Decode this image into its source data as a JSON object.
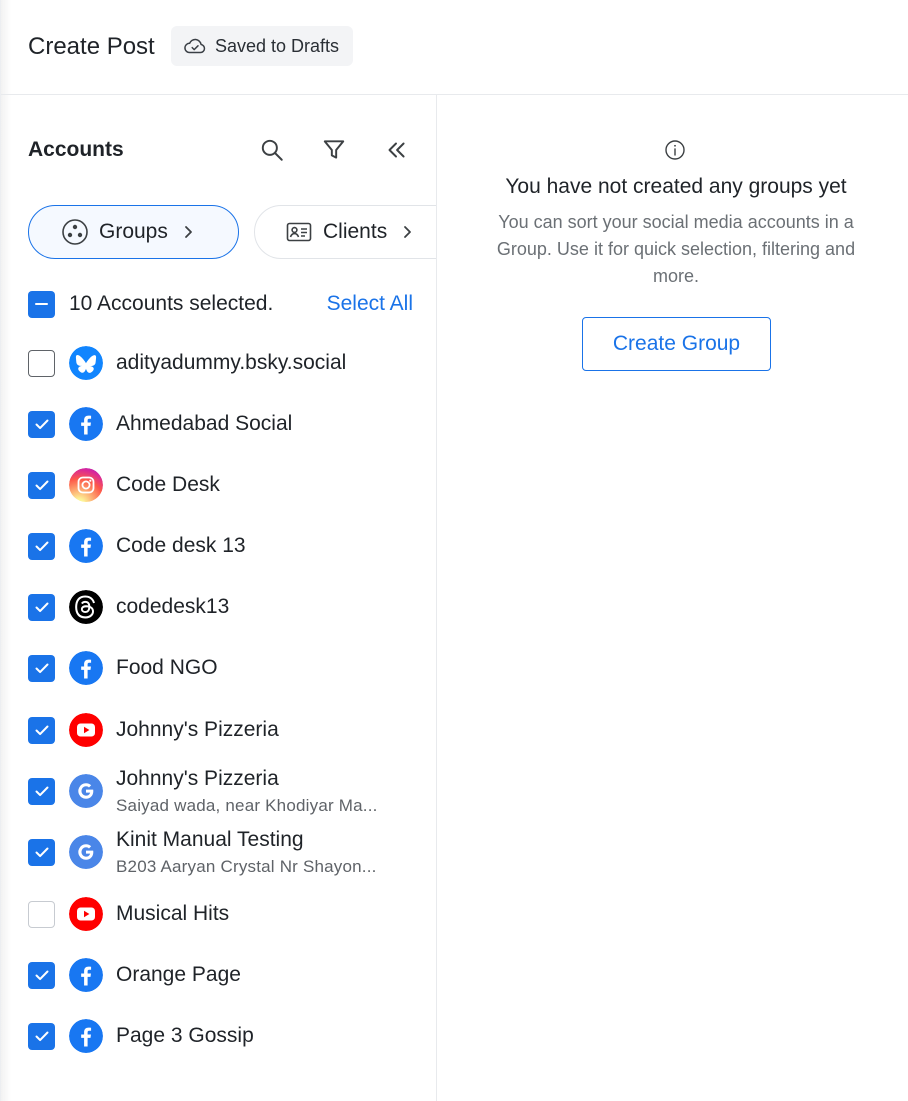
{
  "header": {
    "title": "Create Post",
    "draft_status": "Saved to Drafts"
  },
  "accounts_panel": {
    "title": "Accounts",
    "tools": [
      "search-icon",
      "filter-icon",
      "collapse-double-chevron-icon"
    ],
    "chips": [
      {
        "label": "Groups",
        "icon": "groups-icon",
        "active": true
      },
      {
        "label": "Clients",
        "icon": "id-card-icon",
        "active": false
      }
    ],
    "selected_text": "10 Accounts selected.",
    "select_all_label": "Select All",
    "accounts": [
      {
        "name": "adityadummy.bsky.social",
        "platform": "bluesky",
        "checked": false,
        "sub": ""
      },
      {
        "name": "Ahmedabad Social",
        "platform": "facebook",
        "checked": true,
        "sub": ""
      },
      {
        "name": "Code Desk",
        "platform": "instagram",
        "checked": true,
        "sub": ""
      },
      {
        "name": "Code desk 13",
        "platform": "facebook",
        "checked": true,
        "sub": ""
      },
      {
        "name": "codedesk13",
        "platform": "threads",
        "checked": true,
        "sub": ""
      },
      {
        "name": "Food NGO",
        "platform": "facebook",
        "checked": true,
        "sub": ""
      },
      {
        "name": "Johnny's Pizzeria",
        "platform": "youtube",
        "checked": true,
        "sub": ""
      },
      {
        "name": "Johnny's Pizzeria",
        "platform": "google",
        "checked": true,
        "sub": "Saiyad wada, near Khodiyar Ma..."
      },
      {
        "name": "Kinit Manual Testing",
        "platform": "google",
        "checked": true,
        "sub": "B203 Aaryan Crystal Nr Shayon..."
      },
      {
        "name": "Musical Hits",
        "platform": "youtube",
        "checked": false,
        "sub": ""
      },
      {
        "name": "Orange Page",
        "platform": "facebook",
        "checked": true,
        "sub": ""
      },
      {
        "name": "Page 3 Gossip",
        "platform": "facebook",
        "checked": true,
        "sub": ""
      }
    ]
  },
  "groups_panel": {
    "empty_title": "You have not created any groups yet",
    "empty_description": "You can sort your social media accounts in a Group. Use it for quick selection, filtering and more.",
    "create_button": "Create Group"
  },
  "colors": {
    "accent": "#1a73e8",
    "facebook": "#1877f2",
    "youtube": "#ff0000",
    "bluesky": "#1185fe",
    "threads": "#000000"
  }
}
